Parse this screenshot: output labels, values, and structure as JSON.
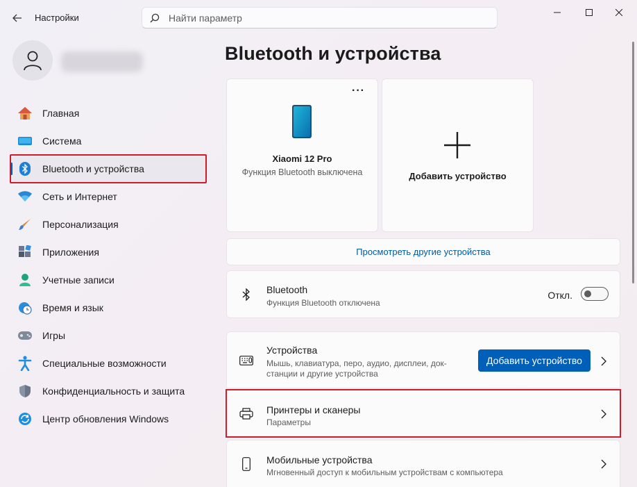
{
  "window": {
    "title": "Настройки",
    "search_placeholder": "Найти параметр"
  },
  "sidebar": {
    "items": [
      {
        "label": "Главная",
        "icon": "home-icon"
      },
      {
        "label": "Система",
        "icon": "display-icon"
      },
      {
        "label": "Bluetooth и устройства",
        "icon": "bluetooth-icon",
        "active": true
      },
      {
        "label": "Сеть и Интернет",
        "icon": "wifi-icon"
      },
      {
        "label": "Персонализация",
        "icon": "brush-icon"
      },
      {
        "label": "Приложения",
        "icon": "apps-icon"
      },
      {
        "label": "Учетные записи",
        "icon": "person-icon"
      },
      {
        "label": "Время и язык",
        "icon": "clock-globe-icon"
      },
      {
        "label": "Игры",
        "icon": "gamepad-icon"
      },
      {
        "label": "Специальные возможности",
        "icon": "accessibility-icon"
      },
      {
        "label": "Конфиденциальность и защита",
        "icon": "shield-icon"
      },
      {
        "label": "Центр обновления Windows",
        "icon": "update-icon"
      }
    ]
  },
  "main": {
    "title": "Bluetooth и устройства",
    "device_card": {
      "name": "Xiaomi 12 Pro",
      "status": "Функция Bluetooth выключена",
      "more": "···"
    },
    "add_card": {
      "label": "Добавить устройство"
    },
    "more_devices_link": "Просмотреть другие устройства",
    "bluetooth_row": {
      "title": "Bluetooth",
      "subtitle": "Функция Bluetooth отключена",
      "toggle_label": "Откл.",
      "toggle_on": false
    },
    "devices_row": {
      "title": "Устройства",
      "subtitle_line1": "Мышь, клавиатура, перо, аудио, дисплеи, док-",
      "subtitle_line2": "станции и другие устройства",
      "button": "Добавить устройство"
    },
    "printers_row": {
      "title": "Принтеры и сканеры",
      "subtitle": "Параметры"
    },
    "mobile_row": {
      "title": "Мобильные устройства",
      "subtitle": "Мгновенный доступ к мобильным устройствам с компьютера"
    }
  },
  "colors": {
    "accent": "#005fb8",
    "highlight_box": "#d11a2a",
    "link": "#005a9e"
  }
}
